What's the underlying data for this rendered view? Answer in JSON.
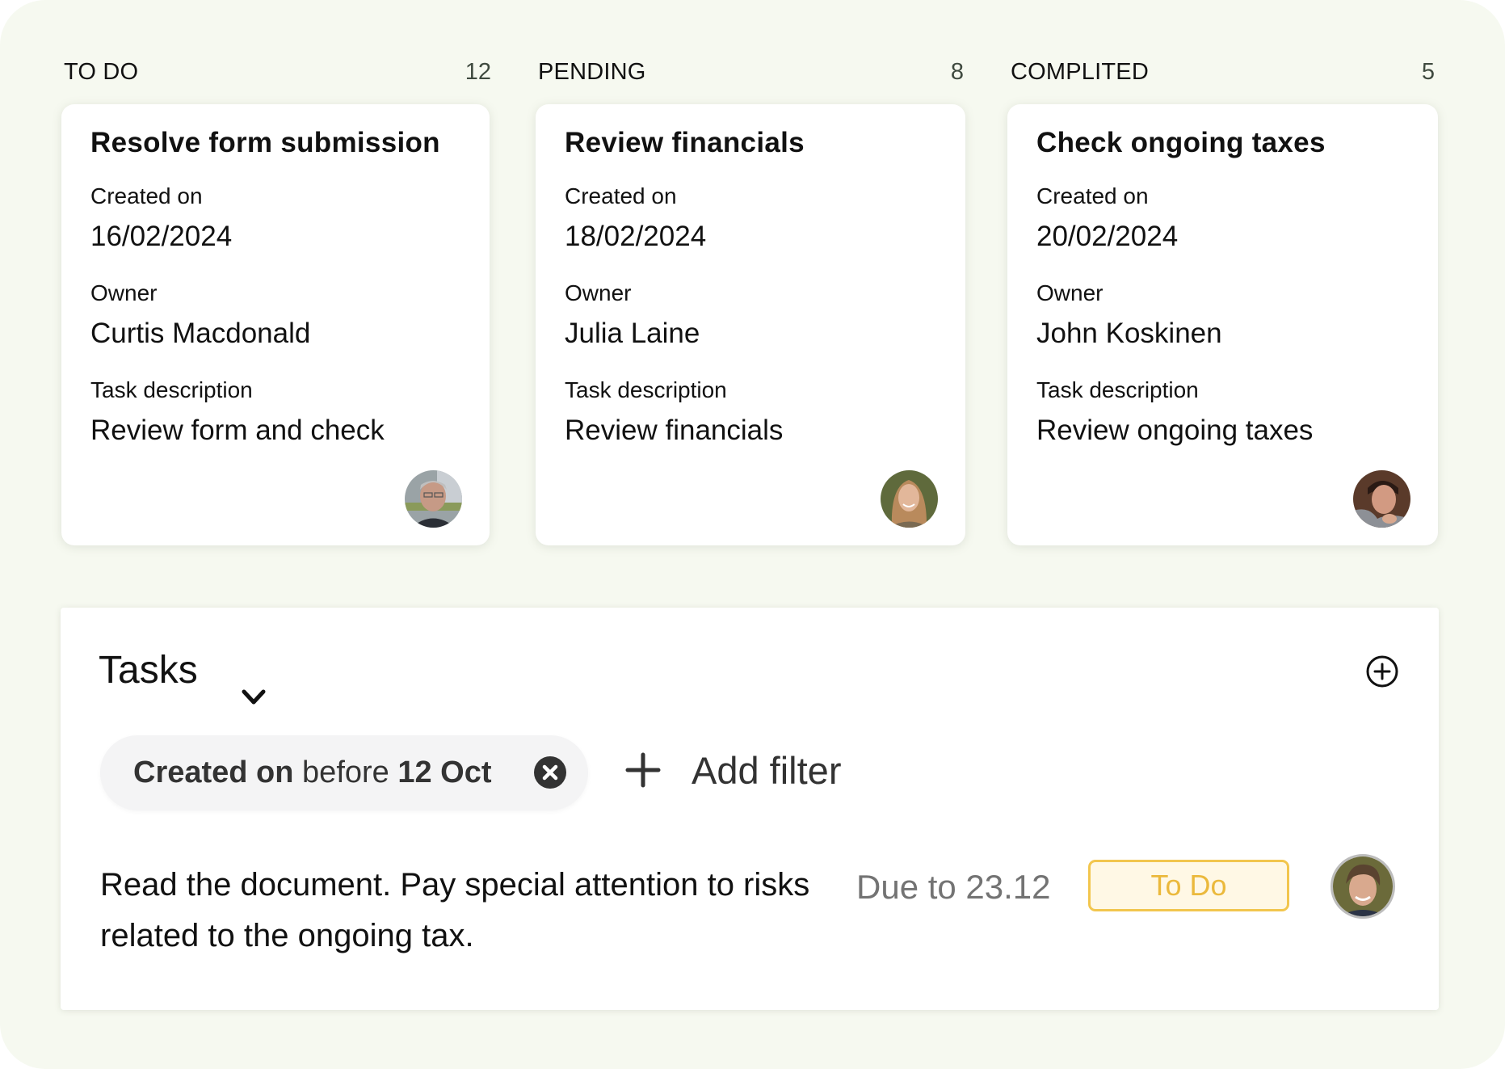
{
  "board": {
    "columns": [
      {
        "title": "TO DO",
        "count": "12",
        "card": {
          "title": "Resolve form submission",
          "created_label": "Created on",
          "created_value": "16/02/2024",
          "owner_label": "Owner",
          "owner_value": "Curtis Macdonald",
          "desc_label": "Task description",
          "desc_value": "Review form and check",
          "avatar": "owner-avatar-curtis-macdonald"
        }
      },
      {
        "title": "PENDING",
        "count": "8",
        "card": {
          "title": "Review financials",
          "created_label": "Created on",
          "created_value": "18/02/2024",
          "owner_label": "Owner",
          "owner_value": "Julia Laine",
          "desc_label": "Task description",
          "desc_value": "Review financials",
          "avatar": "owner-avatar-julia-laine"
        }
      },
      {
        "title": "COMPLITED",
        "count": "5",
        "card": {
          "title": "Check ongoing taxes",
          "created_label": "Created on",
          "created_value": "20/02/2024",
          "owner_label": "Owner",
          "owner_value": "John Koskinen",
          "desc_label": "Task description",
          "desc_value": "Review ongoing taxes",
          "avatar": "owner-avatar-john-koskinen"
        }
      }
    ]
  },
  "tasks_panel": {
    "title": "Tasks",
    "dropdown_icon": "chevron-down-icon",
    "add_icon": "plus-circle-icon",
    "filter_chip": {
      "field": "Created on",
      "operator": "before",
      "value": "12 Oct",
      "remove_icon": "close-circle-icon"
    },
    "add_filter": {
      "icon": "plus-icon",
      "label": "Add filter"
    },
    "task_row": {
      "description": "Read the document. Pay special attention to risks related to the ongoing tax.",
      "due": "Due to 23.12",
      "status": "To Do",
      "assignee_avatar": "assignee-avatar"
    }
  },
  "colors": {
    "background": "#F6F9F0",
    "status_todo_border": "#F2C64E",
    "status_todo_bg": "#FFF8E5",
    "status_todo_text": "#EBB93C",
    "due_text": "#737373"
  }
}
